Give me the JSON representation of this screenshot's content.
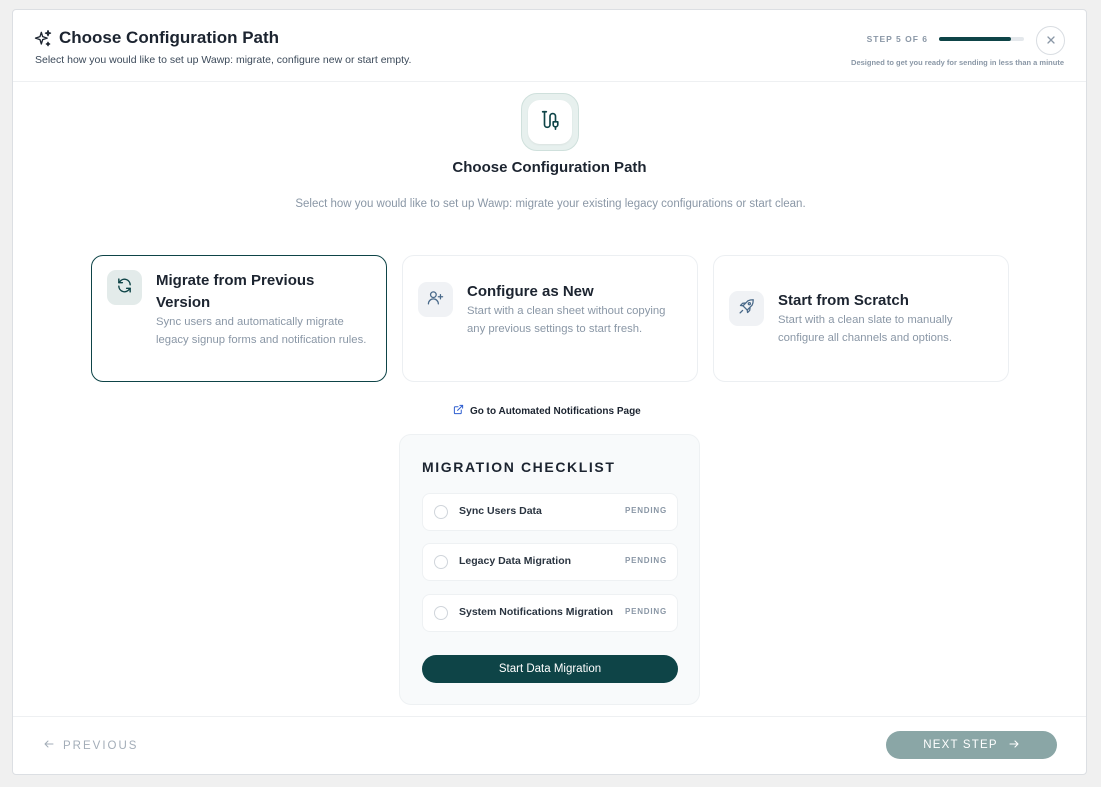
{
  "header": {
    "title": "Choose Configuration Path",
    "subtitle": "Select how you would like to set up Wawp: migrate, configure new or start empty.",
    "step_label": "STEP 5 OF 6",
    "step_progress": 0.85,
    "step_note": "Designed to get you ready for sending in less than a minute"
  },
  "hero": {
    "title": "Choose Configuration Path",
    "description": "Select how you would like to set up Wawp: migrate your existing legacy configurations or start clean."
  },
  "options": [
    {
      "title": "Migrate from Previous Version",
      "description": "Sync users and automatically migrate legacy signup forms and notification rules.",
      "icon": "refresh-icon",
      "selected": true
    },
    {
      "title": "Configure as New",
      "description": "Start with a clean sheet without copying any previous settings to start fresh.",
      "icon": "user-plus-icon",
      "selected": false
    },
    {
      "title": "Start from Scratch",
      "description": "Start with a clean slate to manually configure all channels and options.",
      "icon": "rocket-icon",
      "selected": false
    }
  ],
  "link": {
    "label": "Go to Automated Notifications Page",
    "icon": "external-link-icon"
  },
  "checklist": {
    "title": "MIGRATION CHECKLIST",
    "items": [
      {
        "label": "Sync Users Data",
        "status": "PENDING"
      },
      {
        "label": "Legacy Data Migration",
        "status": "PENDING"
      },
      {
        "label": "System Notifications Migration",
        "status": "PENDING"
      }
    ],
    "button": "Start Data Migration"
  },
  "footer": {
    "previous": "PREVIOUS",
    "next": "NEXT STEP"
  },
  "colors": {
    "primary": "#0e4447",
    "next_button": "#8aa6a6",
    "muted_text": "#8a97a6"
  }
}
